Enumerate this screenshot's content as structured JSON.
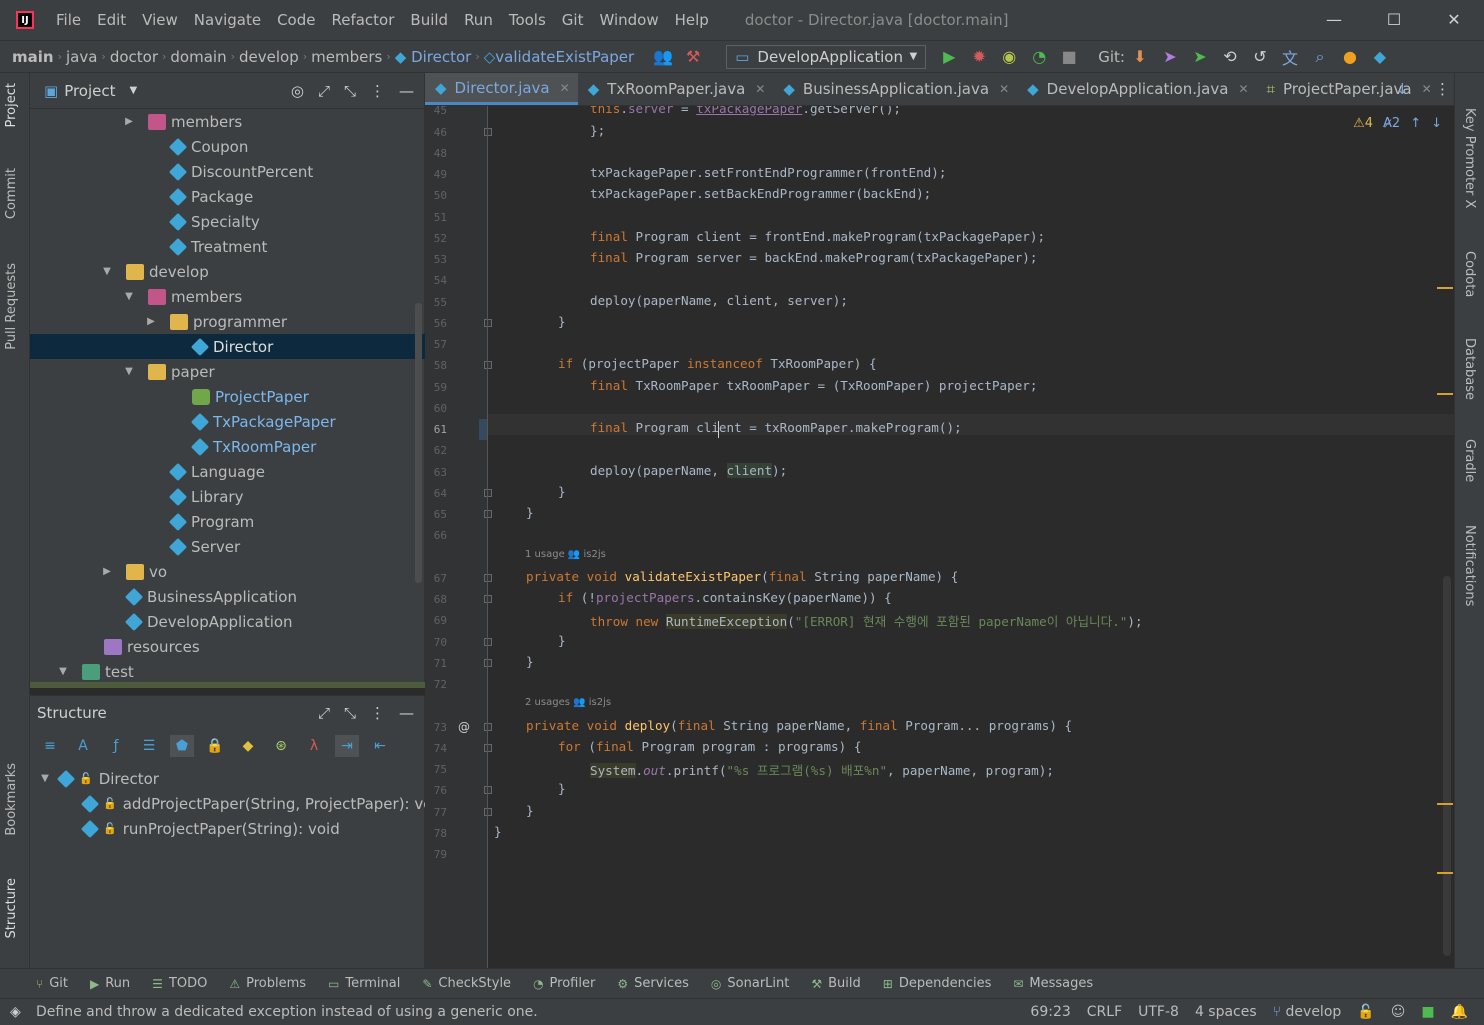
{
  "window": {
    "title": "doctor - Director.java [doctor.main]",
    "menu": [
      "File",
      "Edit",
      "View",
      "Navigate",
      "Code",
      "Refactor",
      "Build",
      "Run",
      "Tools",
      "Git",
      "Window",
      "Help"
    ],
    "minimize": "—",
    "maximize": "☐",
    "close": "✕"
  },
  "navbar": {
    "crumbs": [
      "main",
      "java",
      "doctor",
      "domain",
      "develop",
      "members"
    ],
    "class_crumb": "Director",
    "method_crumb": "validateExistPaper",
    "run_config": "DevelopApplication",
    "git_label": "Git:"
  },
  "left_strip": {
    "project": "Project",
    "commit": "Commit",
    "pull_requests": "Pull Requests",
    "bookmarks": "Bookmarks",
    "structure": "Structure"
  },
  "right_strip": {
    "key_promoter": "Key Promoter X",
    "codota": "Codota",
    "database": "Database",
    "gradle": "Gradle",
    "notifications": "Notifications"
  },
  "project_panel": {
    "title": "Project",
    "tree": [
      {
        "label": "members",
        "icon": "package-icon",
        "indent": 3,
        "arrow": "right"
      },
      {
        "label": "Coupon",
        "icon": "class-icon",
        "indent": 4,
        "arrow": ""
      },
      {
        "label": "DiscountPercent",
        "icon": "class-icon",
        "indent": 4,
        "arrow": ""
      },
      {
        "label": "Package",
        "icon": "class-icon",
        "indent": 4,
        "arrow": ""
      },
      {
        "label": "Specialty",
        "icon": "class-icon",
        "indent": 4,
        "arrow": ""
      },
      {
        "label": "Treatment",
        "icon": "class-icon",
        "indent": 4,
        "arrow": ""
      },
      {
        "label": "develop",
        "icon": "folder-icon",
        "indent": 2,
        "arrow": "down"
      },
      {
        "label": "members",
        "icon": "package-icon",
        "indent": 3,
        "arrow": "down"
      },
      {
        "label": "programmer",
        "icon": "folder-icon",
        "indent": 4,
        "arrow": "right"
      },
      {
        "label": "Director",
        "icon": "class-icon",
        "indent": 5,
        "arrow": "",
        "selected": true
      },
      {
        "label": "paper",
        "icon": "folder-icon",
        "indent": 3,
        "arrow": "down"
      },
      {
        "label": "ProjectPaper",
        "icon": "interface-icon",
        "indent": 5,
        "arrow": "",
        "blue": true
      },
      {
        "label": "TxPackagePaper",
        "icon": "class-icon",
        "indent": 5,
        "arrow": "",
        "blue": true
      },
      {
        "label": "TxRoomPaper",
        "icon": "class-icon",
        "indent": 5,
        "arrow": "",
        "blue": true
      },
      {
        "label": "Language",
        "icon": "class-icon",
        "indent": 4,
        "arrow": ""
      },
      {
        "label": "Library",
        "icon": "class-icon",
        "indent": 4,
        "arrow": ""
      },
      {
        "label": "Program",
        "icon": "class-icon",
        "indent": 4,
        "arrow": ""
      },
      {
        "label": "Server",
        "icon": "class-icon",
        "indent": 4,
        "arrow": ""
      },
      {
        "label": "vo",
        "icon": "folder-icon",
        "indent": 2,
        "arrow": "right"
      },
      {
        "label": "BusinessApplication",
        "icon": "class-icon",
        "indent": 2,
        "arrow": ""
      },
      {
        "label": "DevelopApplication",
        "icon": "class-icon",
        "indent": 2,
        "arrow": ""
      },
      {
        "label": "resources",
        "icon": "resources-folder-icon",
        "indent": 1,
        "arrow": ""
      },
      {
        "label": "test",
        "icon": "test-folder-icon",
        "indent": 0,
        "arrow": "down"
      }
    ]
  },
  "structure_panel": {
    "title": "Structure",
    "root": "Director",
    "members": [
      "addProjectPaper(String, ProjectPaper): void",
      "runProjectPaper(String): void"
    ]
  },
  "tabs": [
    {
      "label": "Director.java",
      "active": true
    },
    {
      "label": "TxRoomPaper.java",
      "active": false
    },
    {
      "label": "BusinessApplication.java",
      "active": false
    },
    {
      "label": "DevelopApplication.java",
      "active": false
    },
    {
      "label": "ProjectPaper.java",
      "active": false
    }
  ],
  "editor": {
    "warnings": "4",
    "weak_warnings": "2",
    "line_numbers": [
      "45",
      "46",
      "48",
      "49",
      "50",
      "51",
      "52",
      "53",
      "54",
      "55",
      "56",
      "57",
      "58",
      "59",
      "60",
      "61",
      "62",
      "63",
      "64",
      "65",
      "66",
      "67",
      "68",
      "69",
      "70",
      "71",
      "72",
      "73",
      "74",
      "75",
      "76",
      "77",
      "78",
      "79"
    ],
    "current_line": "61",
    "inlay_usage_1": "1 usage",
    "inlay_author_1": "is2js",
    "inlay_usage_2": "2 usages",
    "inlay_author_2": "is2js",
    "lines": {
      "l45": "this.server = txPackagePaper.getServer();",
      "l46": "};",
      "l49": "txPackagePaper.setFrontEndProgrammer(frontEnd);",
      "l50": "txPackagePaper.setBackEndProgrammer(backEnd);",
      "l52": "final Program client = frontEnd.makeProgram(txPackagePaper);",
      "l53": "final Program server = backEnd.makeProgram(txPackagePaper);",
      "l55": "deploy(paperName, client, server);",
      "l56": "}",
      "l58": "if (projectPaper instanceof TxRoomPaper) {",
      "l59": "final TxRoomPaper txRoomPaper = (TxRoomPaper) projectPaper;",
      "l61": "final Program client = txRoomPaper.makeProgram();",
      "l63": "deploy(paperName, client);",
      "l64": "}",
      "l65": "}",
      "l67": "private void validateExistPaper(final String paperName) {",
      "l68": "if (!projectPapers.containsKey(paperName)) {",
      "l69": "throw new RuntimeException(\"[ERROR] 현재 수행에 포함된 paperName이 아닙니다.\");",
      "l70": "}",
      "l71": "}",
      "l73": "private void deploy(final String paperName, final Program... programs) {",
      "l74": "for (final Program program : programs) {",
      "l75": "System.out.printf(\"%s 프로그램(%s) 배포%n\", paperName, program);",
      "l76": "}",
      "l77": "}",
      "l78": "}"
    }
  },
  "bottom_tools": [
    "Git",
    "Run",
    "TODO",
    "Problems",
    "Terminal",
    "CheckStyle",
    "Profiler",
    "Services",
    "SonarLint",
    "Build",
    "Dependencies",
    "Messages"
  ],
  "status": {
    "message": "Define and throw a dedicated exception instead of using a generic one.",
    "position": "69:23",
    "line_sep": "CRLF",
    "encoding": "UTF-8",
    "indent": "4 spaces",
    "branch": "develop"
  },
  "colors": {
    "keyword": "#cc7832",
    "field": "#9876aa",
    "string": "#6a8759",
    "method": "#ffc66d",
    "accent": "#4a88c7"
  }
}
